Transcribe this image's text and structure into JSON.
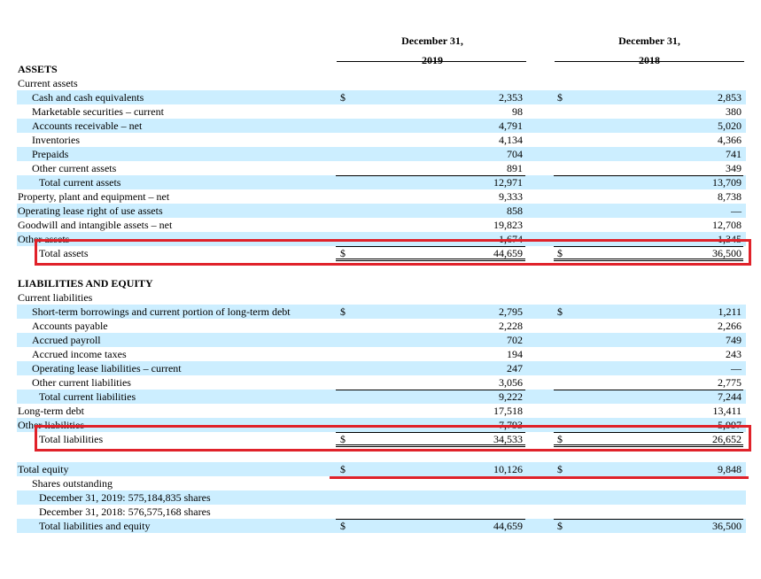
{
  "header": {
    "col1_line1": "December 31,",
    "col1_line2": "2019",
    "col2_line1": "December 31,",
    "col2_line2": "2018"
  },
  "rows": [
    {
      "label": "ASSETS",
      "type": "section",
      "indent": 0,
      "blue": false,
      "c1": "",
      "c2": ""
    },
    {
      "label": "Current assets",
      "indent": 0,
      "blue": false,
      "c1": "",
      "c2": ""
    },
    {
      "label": "Cash and cash equivalents",
      "indent": 1,
      "blue": true,
      "dollar1": "$",
      "c1": "2,353",
      "dollar2": "$",
      "c2": "2,853"
    },
    {
      "label": "Marketable securities – current",
      "indent": 1,
      "blue": false,
      "c1": "98",
      "c2": "380"
    },
    {
      "label": "Accounts receivable – net",
      "indent": 1,
      "blue": true,
      "c1": "4,791",
      "c2": "5,020"
    },
    {
      "label": "Inventories",
      "indent": 1,
      "blue": false,
      "c1": "4,134",
      "c2": "4,366"
    },
    {
      "label": "Prepaids",
      "indent": 1,
      "blue": true,
      "c1": "704",
      "c2": "741"
    },
    {
      "label": "Other current assets",
      "indent": 1,
      "blue": false,
      "c1": "891",
      "c2": "349"
    },
    {
      "label": "Total current assets",
      "indent": 2,
      "blue": true,
      "c1": "12,971",
      "c2": "13,709",
      "topline": true
    },
    {
      "label": "Property, plant and equipment – net",
      "indent": 0,
      "blue": false,
      "c1": "9,333",
      "c2": "8,738"
    },
    {
      "label": "Operating lease right of use assets",
      "indent": 0,
      "blue": true,
      "c1": "858",
      "c2": "—"
    },
    {
      "label": "Goodwill and intangible assets – net",
      "indent": 0,
      "blue": false,
      "c1": "19,823",
      "c2": "12,708"
    },
    {
      "label": "Other assets",
      "indent": 0,
      "blue": true,
      "c1": "1,674",
      "c2": "1,345"
    },
    {
      "label": "Total assets",
      "indent": 2,
      "blue": false,
      "dollar1": "$",
      "c1": "44,659",
      "dollar2": "$",
      "c2": "36,500",
      "topline": true,
      "doubleline": true,
      "highlight": "box"
    },
    {
      "label": "",
      "indent": 0,
      "blue": false,
      "c1": "",
      "c2": "",
      "spacer": true
    },
    {
      "label": "LIABILITIES AND EQUITY",
      "type": "section",
      "indent": 0,
      "blue": false,
      "c1": "",
      "c2": ""
    },
    {
      "label": "Current liabilities",
      "indent": 0,
      "blue": false,
      "c1": "",
      "c2": ""
    },
    {
      "label": "Short-term borrowings and current portion of long-term debt",
      "indent": 1,
      "blue": true,
      "dollar1": "$",
      "c1": "2,795",
      "dollar2": "$",
      "c2": "1,211"
    },
    {
      "label": "Accounts payable",
      "indent": 1,
      "blue": false,
      "c1": "2,228",
      "c2": "2,266"
    },
    {
      "label": "Accrued payroll",
      "indent": 1,
      "blue": true,
      "c1": "702",
      "c2": "749"
    },
    {
      "label": "Accrued income taxes",
      "indent": 1,
      "blue": false,
      "c1": "194",
      "c2": "243"
    },
    {
      "label": "Operating lease liabilities – current",
      "indent": 1,
      "blue": true,
      "c1": "247",
      "c2": "—"
    },
    {
      "label": "Other current liabilities",
      "indent": 1,
      "blue": false,
      "c1": "3,056",
      "c2": "2,775"
    },
    {
      "label": "Total current liabilities",
      "indent": 2,
      "blue": true,
      "c1": "9,222",
      "c2": "7,244",
      "topline": true
    },
    {
      "label": "Long-term debt",
      "indent": 0,
      "blue": false,
      "c1": "17,518",
      "c2": "13,411"
    },
    {
      "label": "Other liabilities",
      "indent": 0,
      "blue": true,
      "c1": "7,793",
      "c2": "5,997"
    },
    {
      "label": "Total liabilities",
      "indent": 2,
      "blue": false,
      "dollar1": "$",
      "c1": "34,533",
      "dollar2": "$",
      "c2": "26,652",
      "topline": true,
      "doubleline": true,
      "highlight": "box"
    },
    {
      "label": "",
      "indent": 0,
      "blue": false,
      "c1": "",
      "c2": "",
      "spacer": true
    },
    {
      "label": "Total equity",
      "indent": 0,
      "blue": true,
      "dollar1": "$",
      "c1": "10,126",
      "dollar2": "$",
      "c2": "9,848",
      "highlight": "underline"
    },
    {
      "label": "Shares outstanding",
      "indent": 1,
      "blue": false,
      "c1": "",
      "c2": ""
    },
    {
      "label": "December 31, 2019: 575,184,835 shares",
      "indent": 2,
      "blue": true,
      "c1": "",
      "c2": ""
    },
    {
      "label": "December 31, 2018: 576,575,168 shares",
      "indent": 2,
      "blue": false,
      "c1": "",
      "c2": ""
    },
    {
      "label": "Total liabilities and equity",
      "indent": 2,
      "blue": true,
      "dollar1": "$",
      "c1": "44,659",
      "dollar2": "$",
      "c2": "36,500",
      "topline": true
    }
  ],
  "colors": {
    "row_band": "#cceeff",
    "highlight": "#e0222a"
  }
}
